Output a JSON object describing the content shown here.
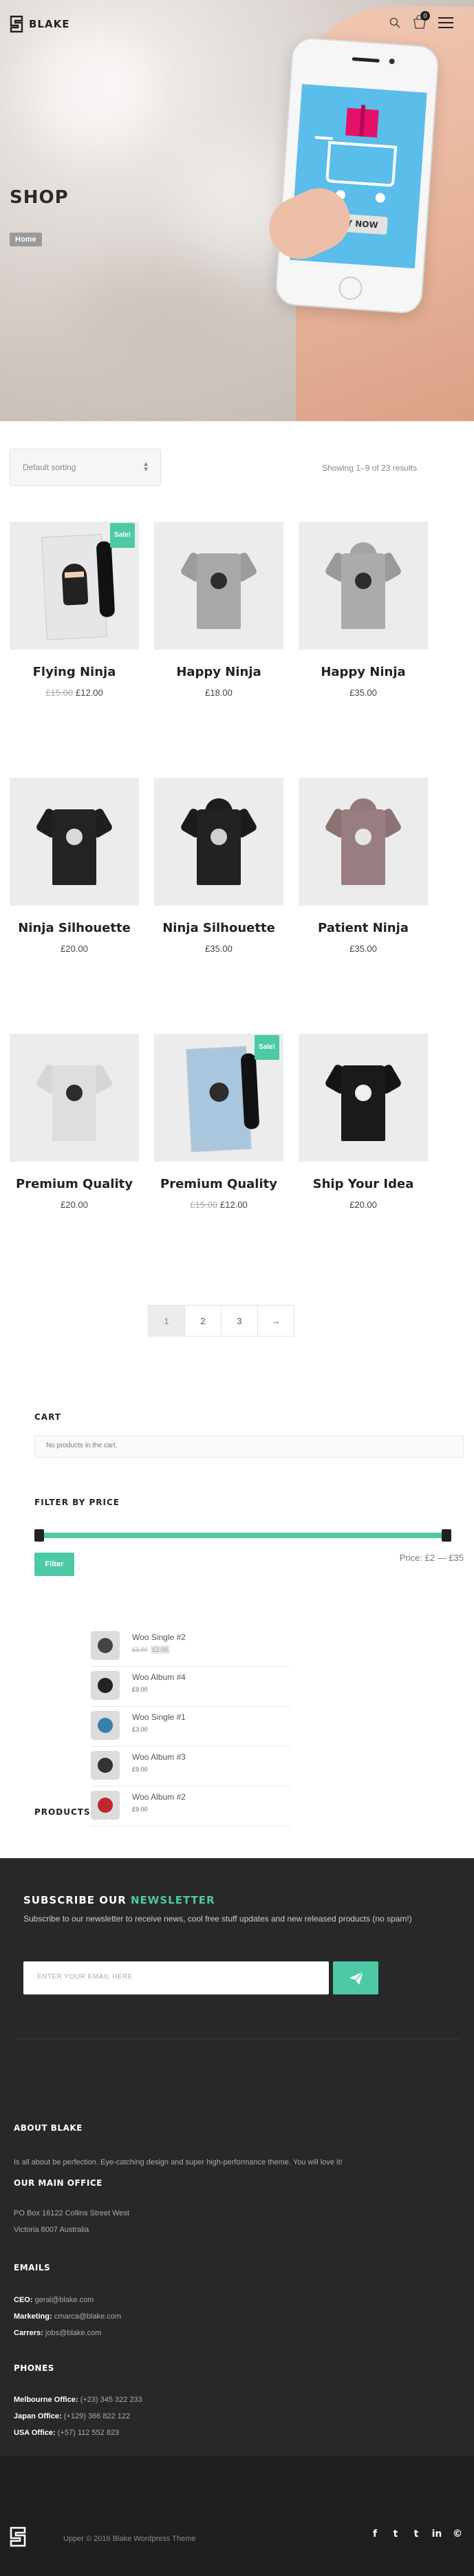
{
  "header": {
    "logo_text": "BLAKE",
    "cart_count": "0"
  },
  "hero": {
    "title": "SHOP",
    "breadcrumb": "Home",
    "phone_button": "BUY NOW"
  },
  "toolbar": {
    "sort_value": "Default sorting",
    "result_count": "Showing 1–9 of 23 results"
  },
  "products": [
    {
      "name": "Flying Ninja",
      "old_price": "£15.00",
      "price": "£12.00",
      "sale": "Sale!"
    },
    {
      "name": "Happy Ninja",
      "price": "£18.00"
    },
    {
      "name": "Happy Ninja",
      "price": "£35.00"
    },
    {
      "name": "Ninja Silhouette",
      "price": "£20.00"
    },
    {
      "name": "Ninja Silhouette",
      "price": "£35.00"
    },
    {
      "name": "Patient Ninja",
      "price": "£35.00"
    },
    {
      "name": "Premium Quality",
      "price": "£20.00"
    },
    {
      "name": "Premium Quality",
      "old_price": "£15.00",
      "price": "£12.00",
      "sale": "Sale!"
    },
    {
      "name": "Ship Your Idea",
      "price": "£20.00"
    }
  ],
  "pagination": [
    "1",
    "2",
    "3",
    "→"
  ],
  "cart_widget": {
    "title": "CART",
    "empty_text": "No products in the cart."
  },
  "price_filter": {
    "title": "FILTER BY PRICE",
    "button": "Filter",
    "range_text": "Price: £2 — £35",
    "min_fraction": 0.0,
    "max_fraction": 1.0
  },
  "products_widget": {
    "title": "PRODUCTS",
    "items": [
      {
        "name": "Woo Single #2",
        "old_price": "£3.00",
        "price": "£2.00"
      },
      {
        "name": "Woo Album #4",
        "price": "£9.00"
      },
      {
        "name": "Woo Single #1",
        "price": "£3.00"
      },
      {
        "name": "Woo Album #3",
        "price": "£9.00"
      },
      {
        "name": "Woo Album #2",
        "price": "£9.00"
      }
    ]
  },
  "newsletter": {
    "title_prefix": "SUBSCRIBE OUR",
    "title_accent": "NEWSLETTER",
    "subtitle": "Subscribe to our newsletter to receive news, cool free stuff updates and new released products (no spam!)",
    "placeholder": "ENTER YOUR EMAIL HERE"
  },
  "footer": {
    "about_title": "ABOUT BLAKE",
    "about_text": "Is all about be perfection. Eye-catching design and super high-performance theme. You will love it!",
    "office_title": "OUR MAIN OFFICE",
    "office_line1": "PO Box 16122 Collins Street West",
    "office_line2": "Victoria 8007 Australia",
    "emails_title": "EMAILS",
    "emails": [
      {
        "label": "CEO:",
        "value": "geral@blake.com"
      },
      {
        "label": "Marketing:",
        "value": "cmarca@blake.com"
      },
      {
        "label": "Carrers:",
        "value": "jobs@blake.com"
      }
    ],
    "phones_title": "PHONES",
    "phones": [
      {
        "label": "Melbourne Office:",
        "value": "(+23) 345 322 233"
      },
      {
        "label": "Japan Office:",
        "value": "(+129) 366 822 122"
      },
      {
        "label": "USA Office:",
        "value": "(+57) 112 552 823"
      }
    ],
    "copyright": "Upper © 2016 Blake Wordpress Theme",
    "social": [
      "f",
      "t",
      "t",
      "in",
      "©"
    ]
  },
  "colors": {
    "accent": "#4ec9a5",
    "dark": "#282828",
    "phone_screen": "#5bbde9",
    "gift": "#e4106a"
  }
}
